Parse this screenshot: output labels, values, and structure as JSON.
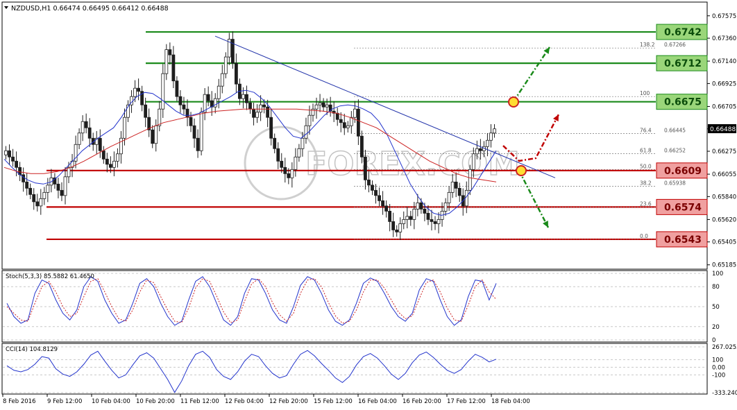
{
  "header": {
    "symbol_line": "NZDUSD,H1  0.66474 0.66495 0.66412 0.66488"
  },
  "colors": {
    "bull": "#1e1e1e",
    "bear": "#1e1e1e",
    "support_red": "#c00000",
    "resistance_green": "#1a8a1a",
    "trendline_blue": "#2233aa",
    "ma_fast": "#2233cc",
    "ma_slow": "#cc2222",
    "label_green_bg": "#9ad67a",
    "label_red_bg": "#f0a0a0",
    "grid": "#c8c8c8",
    "current_price_bg": "#000000"
  },
  "chart_data": {
    "type": "candlestick",
    "instrument": "NZDUSD",
    "timeframe": "H1",
    "ohlc": {
      "open": 0.66474,
      "high": 0.66495,
      "low": 0.66412,
      "close": 0.66488
    },
    "current_price": "0.66488",
    "ylim": [
      0.6515,
      0.677
    ],
    "y_ticks": [
      "0.67575",
      "0.67360",
      "0.67140",
      "0.66925",
      "0.66705",
      "0.66490",
      "0.66275",
      "0.66055",
      "0.65840",
      "0.65620",
      "0.65405",
      "0.65185"
    ],
    "x_ticks": [
      "8 Feb 2016",
      "9 Feb 12:00",
      "10 Feb 04:00",
      "10 Feb 20:00",
      "11 Feb 12:00",
      "12 Feb 04:00",
      "12 Feb 20:00",
      "15 Feb 12:00",
      "16 Feb 04:00",
      "16 Feb 20:00",
      "17 Feb 12:00",
      "18 Feb 04:00"
    ],
    "levels": [
      {
        "price": 0.6742,
        "label": "0.6742",
        "kind": "resistance"
      },
      {
        "price": 0.6712,
        "label": "0.6712",
        "kind": "resistance"
      },
      {
        "price": 0.6675,
        "label": "0.6675",
        "kind": "resistance"
      },
      {
        "price": 0.6609,
        "label": "0.6609",
        "kind": "support"
      },
      {
        "price": 0.6574,
        "label": "0.6574",
        "kind": "support"
      },
      {
        "price": 0.6543,
        "label": "0.6543",
        "kind": "support"
      }
    ],
    "fibonacci": [
      {
        "ratio": "138.2",
        "value": "0.67266",
        "price": 0.67266
      },
      {
        "ratio": "100",
        "value": "",
        "price": 0.668
      },
      {
        "ratio": "76.4",
        "value": "0.66445",
        "price": 0.66445
      },
      {
        "ratio": "61.8",
        "value": "0.66252",
        "price": 0.66252
      },
      {
        "ratio": "50.0",
        "value": "",
        "price": 0.661
      },
      {
        "ratio": "38.2",
        "value": "0.65938",
        "price": 0.65938
      },
      {
        "ratio": "23.6",
        "value": "",
        "price": 0.6574
      },
      {
        "ratio": "0.0",
        "value": "",
        "price": 0.6543
      }
    ],
    "candles_close": [
      0.6628,
      0.6622,
      0.6618,
      0.6612,
      0.6605,
      0.6598,
      0.6592,
      0.6586,
      0.6579,
      0.6575,
      0.6582,
      0.6588,
      0.6595,
      0.6602,
      0.6596,
      0.659,
      0.6585,
      0.6603,
      0.6612,
      0.6618,
      0.6634,
      0.6645,
      0.6656,
      0.665,
      0.664,
      0.6634,
      0.664,
      0.6628,
      0.662,
      0.6615,
      0.6612,
      0.6618,
      0.6625,
      0.664,
      0.666,
      0.6672,
      0.668,
      0.6688,
      0.6685,
      0.6672,
      0.666,
      0.6648,
      0.6635,
      0.6652,
      0.6668,
      0.6702,
      0.6725,
      0.672,
      0.6695,
      0.668,
      0.6672,
      0.6668,
      0.666,
      0.6652,
      0.664,
      0.6628,
      0.6665,
      0.6682,
      0.6676,
      0.667,
      0.6678,
      0.669,
      0.6702,
      0.6718,
      0.6735,
      0.6712,
      0.6692,
      0.6678,
      0.6682,
      0.6674,
      0.6668,
      0.666,
      0.6665,
      0.6672,
      0.667,
      0.666,
      0.664,
      0.663,
      0.6618,
      0.6612,
      0.6606,
      0.6602,
      0.661,
      0.6622,
      0.663,
      0.664,
      0.6652,
      0.6662,
      0.6668,
      0.6672,
      0.6674,
      0.667,
      0.6672,
      0.6666,
      0.6664,
      0.6658,
      0.6655,
      0.665,
      0.6652,
      0.666,
      0.6668,
      0.6642,
      0.6622,
      0.66,
      0.6595,
      0.659,
      0.6585,
      0.658,
      0.6575,
      0.657,
      0.656,
      0.6552,
      0.655,
      0.6558,
      0.6562,
      0.6565,
      0.6562,
      0.6572,
      0.6578,
      0.6572,
      0.6568,
      0.6562,
      0.656,
      0.6558,
      0.6562,
      0.657,
      0.6578,
      0.6588,
      0.6598,
      0.6592,
      0.6585,
      0.6575,
      0.659,
      0.661,
      0.6625,
      0.663,
      0.6628,
      0.6632,
      0.6638,
      0.6645,
      0.6649
    ],
    "ma_fast": [
      0.662,
      0.6612,
      0.6605,
      0.66,
      0.6597,
      0.6596,
      0.6598,
      0.6604,
      0.6612,
      0.662,
      0.6628,
      0.6634,
      0.664,
      0.6645,
      0.665,
      0.666,
      0.6672,
      0.668,
      0.6684,
      0.6683,
      0.6678,
      0.6672,
      0.6666,
      0.6662,
      0.6662,
      0.6664,
      0.6668,
      0.6672,
      0.6676,
      0.668,
      0.6685,
      0.6686,
      0.6684,
      0.6678,
      0.667,
      0.666,
      0.665,
      0.6642,
      0.664,
      0.6646,
      0.6654,
      0.6662,
      0.6668,
      0.6671,
      0.6672,
      0.6671,
      0.6668,
      0.6664,
      0.6656,
      0.6644,
      0.6628,
      0.6612,
      0.6596,
      0.6584,
      0.6574,
      0.6568,
      0.6566,
      0.6568,
      0.6574,
      0.6582,
      0.6592,
      0.6604,
      0.6616,
      0.6628
    ],
    "ma_slow": [
      0.6612,
      0.6608,
      0.6606,
      0.6606,
      0.6608,
      0.6612,
      0.6618,
      0.6625,
      0.6632,
      0.6638,
      0.6644,
      0.665,
      0.6655,
      0.6658,
      0.6661,
      0.6664,
      0.6666,
      0.6667,
      0.6668,
      0.6668,
      0.6668,
      0.6668,
      0.6668,
      0.6667,
      0.6666,
      0.6664,
      0.666,
      0.6655,
      0.665,
      0.6642,
      0.6634,
      0.6626,
      0.6618,
      0.6612,
      0.6606,
      0.6602,
      0.66,
      0.6598
    ],
    "trendline": {
      "from_price": 0.6738,
      "to_price": 0.6602
    },
    "stochastic": {
      "label": "Stoch(5,3,3) 85.5882 61.4650",
      "levels": [
        "100",
        "80",
        "50",
        "20",
        "0"
      ],
      "main": [
        55,
        35,
        25,
        30,
        70,
        90,
        85,
        60,
        40,
        30,
        45,
        80,
        95,
        88,
        60,
        40,
        25,
        30,
        55,
        85,
        92,
        80,
        55,
        35,
        22,
        28,
        60,
        88,
        95,
        80,
        55,
        30,
        22,
        35,
        70,
        92,
        90,
        70,
        45,
        30,
        25,
        50,
        82,
        95,
        90,
        70,
        45,
        28,
        22,
        30,
        55,
        85,
        93,
        88,
        70,
        50,
        35,
        28,
        40,
        75,
        92,
        88,
        60,
        35,
        22,
        30,
        65,
        90,
        88,
        60,
        85
      ],
      "signal": [
        50,
        40,
        30,
        28,
        55,
        80,
        88,
        72,
        50,
        35,
        40,
        65,
        88,
        92,
        72,
        50,
        32,
        28,
        45,
        72,
        90,
        86,
        65,
        45,
        28,
        26,
        48,
        78,
        92,
        88,
        66,
        42,
        26,
        30,
        58,
        84,
        92,
        80,
        56,
        38,
        28,
        40,
        70,
        90,
        92,
        80,
        56,
        36,
        25,
        28,
        45,
        72,
        90,
        90,
        78,
        60,
        42,
        32,
        36,
        62,
        86,
        90,
        72,
        48,
        30,
        28,
        52,
        80,
        90,
        72,
        61
      ]
    },
    "cci": {
      "label": "CCI(14) 104.8129",
      "levels": [
        "267.0255",
        "100",
        "0.00",
        "-100",
        "-333.2400"
      ],
      "values": [
        20,
        -40,
        -60,
        -30,
        40,
        140,
        120,
        -20,
        -90,
        -120,
        -60,
        40,
        160,
        210,
        80,
        -40,
        -140,
        -100,
        30,
        150,
        190,
        120,
        -20,
        -160,
        -330,
        -180,
        20,
        170,
        210,
        130,
        -30,
        -120,
        -160,
        -60,
        80,
        170,
        140,
        20,
        -80,
        -140,
        -110,
        40,
        170,
        220,
        150,
        50,
        -40,
        -140,
        -200,
        -120,
        30,
        140,
        180,
        120,
        20,
        -90,
        -160,
        -80,
        60,
        160,
        200,
        130,
        40,
        -40,
        -80,
        -30,
        80,
        170,
        130,
        70,
        105
      ]
    }
  },
  "watermark": "FOREX.COM"
}
